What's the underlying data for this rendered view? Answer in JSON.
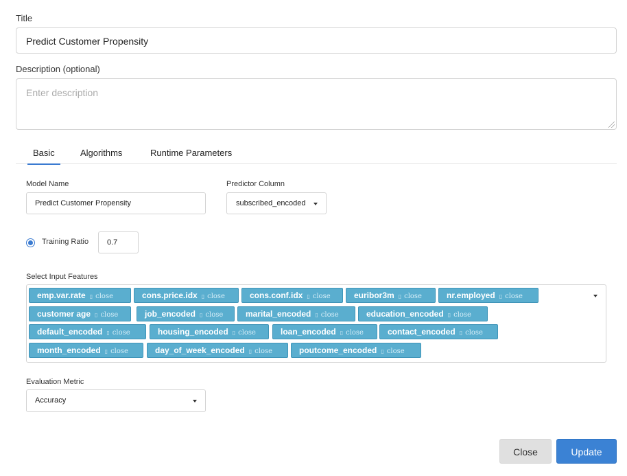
{
  "form": {
    "title_label": "Title",
    "title_value": "Predict Customer Propensity",
    "description_label": "Description (optional)",
    "description_placeholder": "Enter description"
  },
  "tabs": [
    {
      "label": "Basic",
      "active": true
    },
    {
      "label": "Algorithms",
      "active": false
    },
    {
      "label": "Runtime Parameters",
      "active": false
    }
  ],
  "basic": {
    "model_name_label": "Model Name",
    "model_name_value": "Predict Customer Propensity",
    "predictor_label": "Predictor Column",
    "predictor_value": "subscribed_encoded",
    "training_ratio_label": "Training Ratio",
    "training_ratio_value": "0.7",
    "training_ratio_selected": true,
    "features_label": "Select Input Features",
    "features": [
      "emp.var.rate",
      "cons.price.idx",
      "cons.conf.idx",
      "euribor3m",
      "nr.employed",
      "customer age",
      "job_encoded",
      "marital_encoded",
      "education_encoded",
      "default_encoded",
      "housing_encoded",
      "loan_encoded",
      "contact_encoded",
      "month_encoded",
      "day_of_week_encoded",
      "poutcome_encoded"
    ],
    "tag_remove_text": "close",
    "tag_remove_glyph": "▯",
    "metric_label": "Evaluation Metric",
    "metric_value": "Accuracy"
  },
  "footer": {
    "close_label": "Close",
    "update_label": "Update"
  },
  "colors": {
    "accent": "#3b82d4",
    "tag_bg": "#5aaecf"
  }
}
